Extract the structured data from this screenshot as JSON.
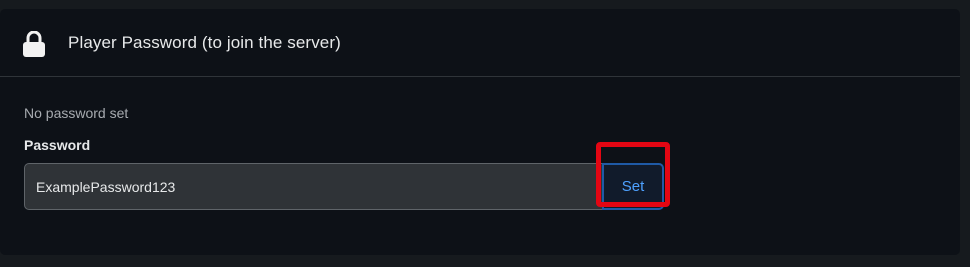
{
  "header": {
    "icon": "lock-icon",
    "title": "Player Password (to join the server)"
  },
  "body": {
    "status_text": "No password set",
    "password_label": "Password",
    "password_value": "ExamplePassword123",
    "set_button_label": "Set"
  },
  "colors": {
    "background": "#0d1117",
    "accent": "#4ea1ff",
    "highlight": "#e30613"
  }
}
